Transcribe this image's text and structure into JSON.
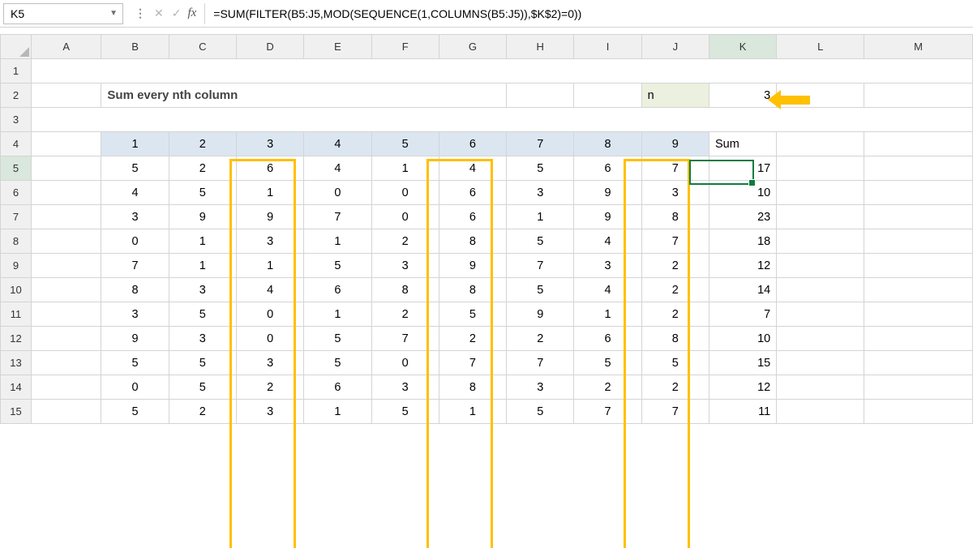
{
  "name_box": "K5",
  "formula": "=SUM(FILTER(B5:J5,MOD(SEQUENCE(1,COLUMNS(B5:J5)),$K$2)=0))",
  "title": "Sum every nth column",
  "n_label": "n",
  "n_value": "3",
  "columns": [
    "A",
    "B",
    "C",
    "D",
    "E",
    "F",
    "G",
    "H",
    "I",
    "J",
    "K",
    "L",
    "M"
  ],
  "row_numbers": [
    "1",
    "2",
    "3",
    "4",
    "5",
    "6",
    "7",
    "8",
    "9",
    "10",
    "11",
    "12",
    "13",
    "14",
    "15"
  ],
  "data_headers": [
    "1",
    "2",
    "3",
    "4",
    "5",
    "6",
    "7",
    "8",
    "9",
    "Sum"
  ],
  "rows": [
    [
      "5",
      "2",
      "6",
      "4",
      "1",
      "4",
      "5",
      "6",
      "7",
      "17"
    ],
    [
      "4",
      "5",
      "1",
      "0",
      "0",
      "6",
      "3",
      "9",
      "3",
      "10"
    ],
    [
      "3",
      "9",
      "9",
      "7",
      "0",
      "6",
      "1",
      "9",
      "8",
      "23"
    ],
    [
      "0",
      "1",
      "3",
      "1",
      "2",
      "8",
      "5",
      "4",
      "7",
      "18"
    ],
    [
      "7",
      "1",
      "1",
      "5",
      "3",
      "9",
      "7",
      "3",
      "2",
      "12"
    ],
    [
      "8",
      "3",
      "4",
      "6",
      "8",
      "8",
      "5",
      "4",
      "2",
      "14"
    ],
    [
      "3",
      "5",
      "0",
      "1",
      "2",
      "5",
      "9",
      "1",
      "2",
      "7"
    ],
    [
      "9",
      "3",
      "0",
      "5",
      "7",
      "2",
      "2",
      "6",
      "8",
      "10"
    ],
    [
      "5",
      "5",
      "3",
      "5",
      "0",
      "7",
      "7",
      "5",
      "5",
      "15"
    ],
    [
      "0",
      "5",
      "2",
      "6",
      "3",
      "8",
      "3",
      "2",
      "2",
      "12"
    ],
    [
      "5",
      "2",
      "3",
      "1",
      "5",
      "1",
      "5",
      "7",
      "7",
      "11"
    ]
  ],
  "chart_data": {
    "type": "table",
    "title": "Sum every nth column",
    "n": 3,
    "headers": [
      "1",
      "2",
      "3",
      "4",
      "5",
      "6",
      "7",
      "8",
      "9",
      "Sum"
    ],
    "data": [
      [
        5,
        2,
        6,
        4,
        1,
        4,
        5,
        6,
        7,
        17
      ],
      [
        4,
        5,
        1,
        0,
        0,
        6,
        3,
        9,
        3,
        10
      ],
      [
        3,
        9,
        9,
        7,
        0,
        6,
        1,
        9,
        8,
        23
      ],
      [
        0,
        1,
        3,
        1,
        2,
        8,
        5,
        4,
        7,
        18
      ],
      [
        7,
        1,
        1,
        5,
        3,
        9,
        7,
        3,
        2,
        12
      ],
      [
        8,
        3,
        4,
        6,
        8,
        8,
        5,
        4,
        2,
        14
      ],
      [
        3,
        5,
        0,
        1,
        2,
        5,
        9,
        1,
        2,
        7
      ],
      [
        9,
        3,
        0,
        5,
        7,
        2,
        2,
        6,
        8,
        10
      ],
      [
        5,
        5,
        3,
        5,
        0,
        7,
        7,
        5,
        5,
        15
      ],
      [
        0,
        5,
        2,
        6,
        3,
        8,
        3,
        2,
        2,
        12
      ],
      [
        5,
        2,
        3,
        1,
        5,
        1,
        5,
        7,
        7,
        11
      ]
    ]
  }
}
